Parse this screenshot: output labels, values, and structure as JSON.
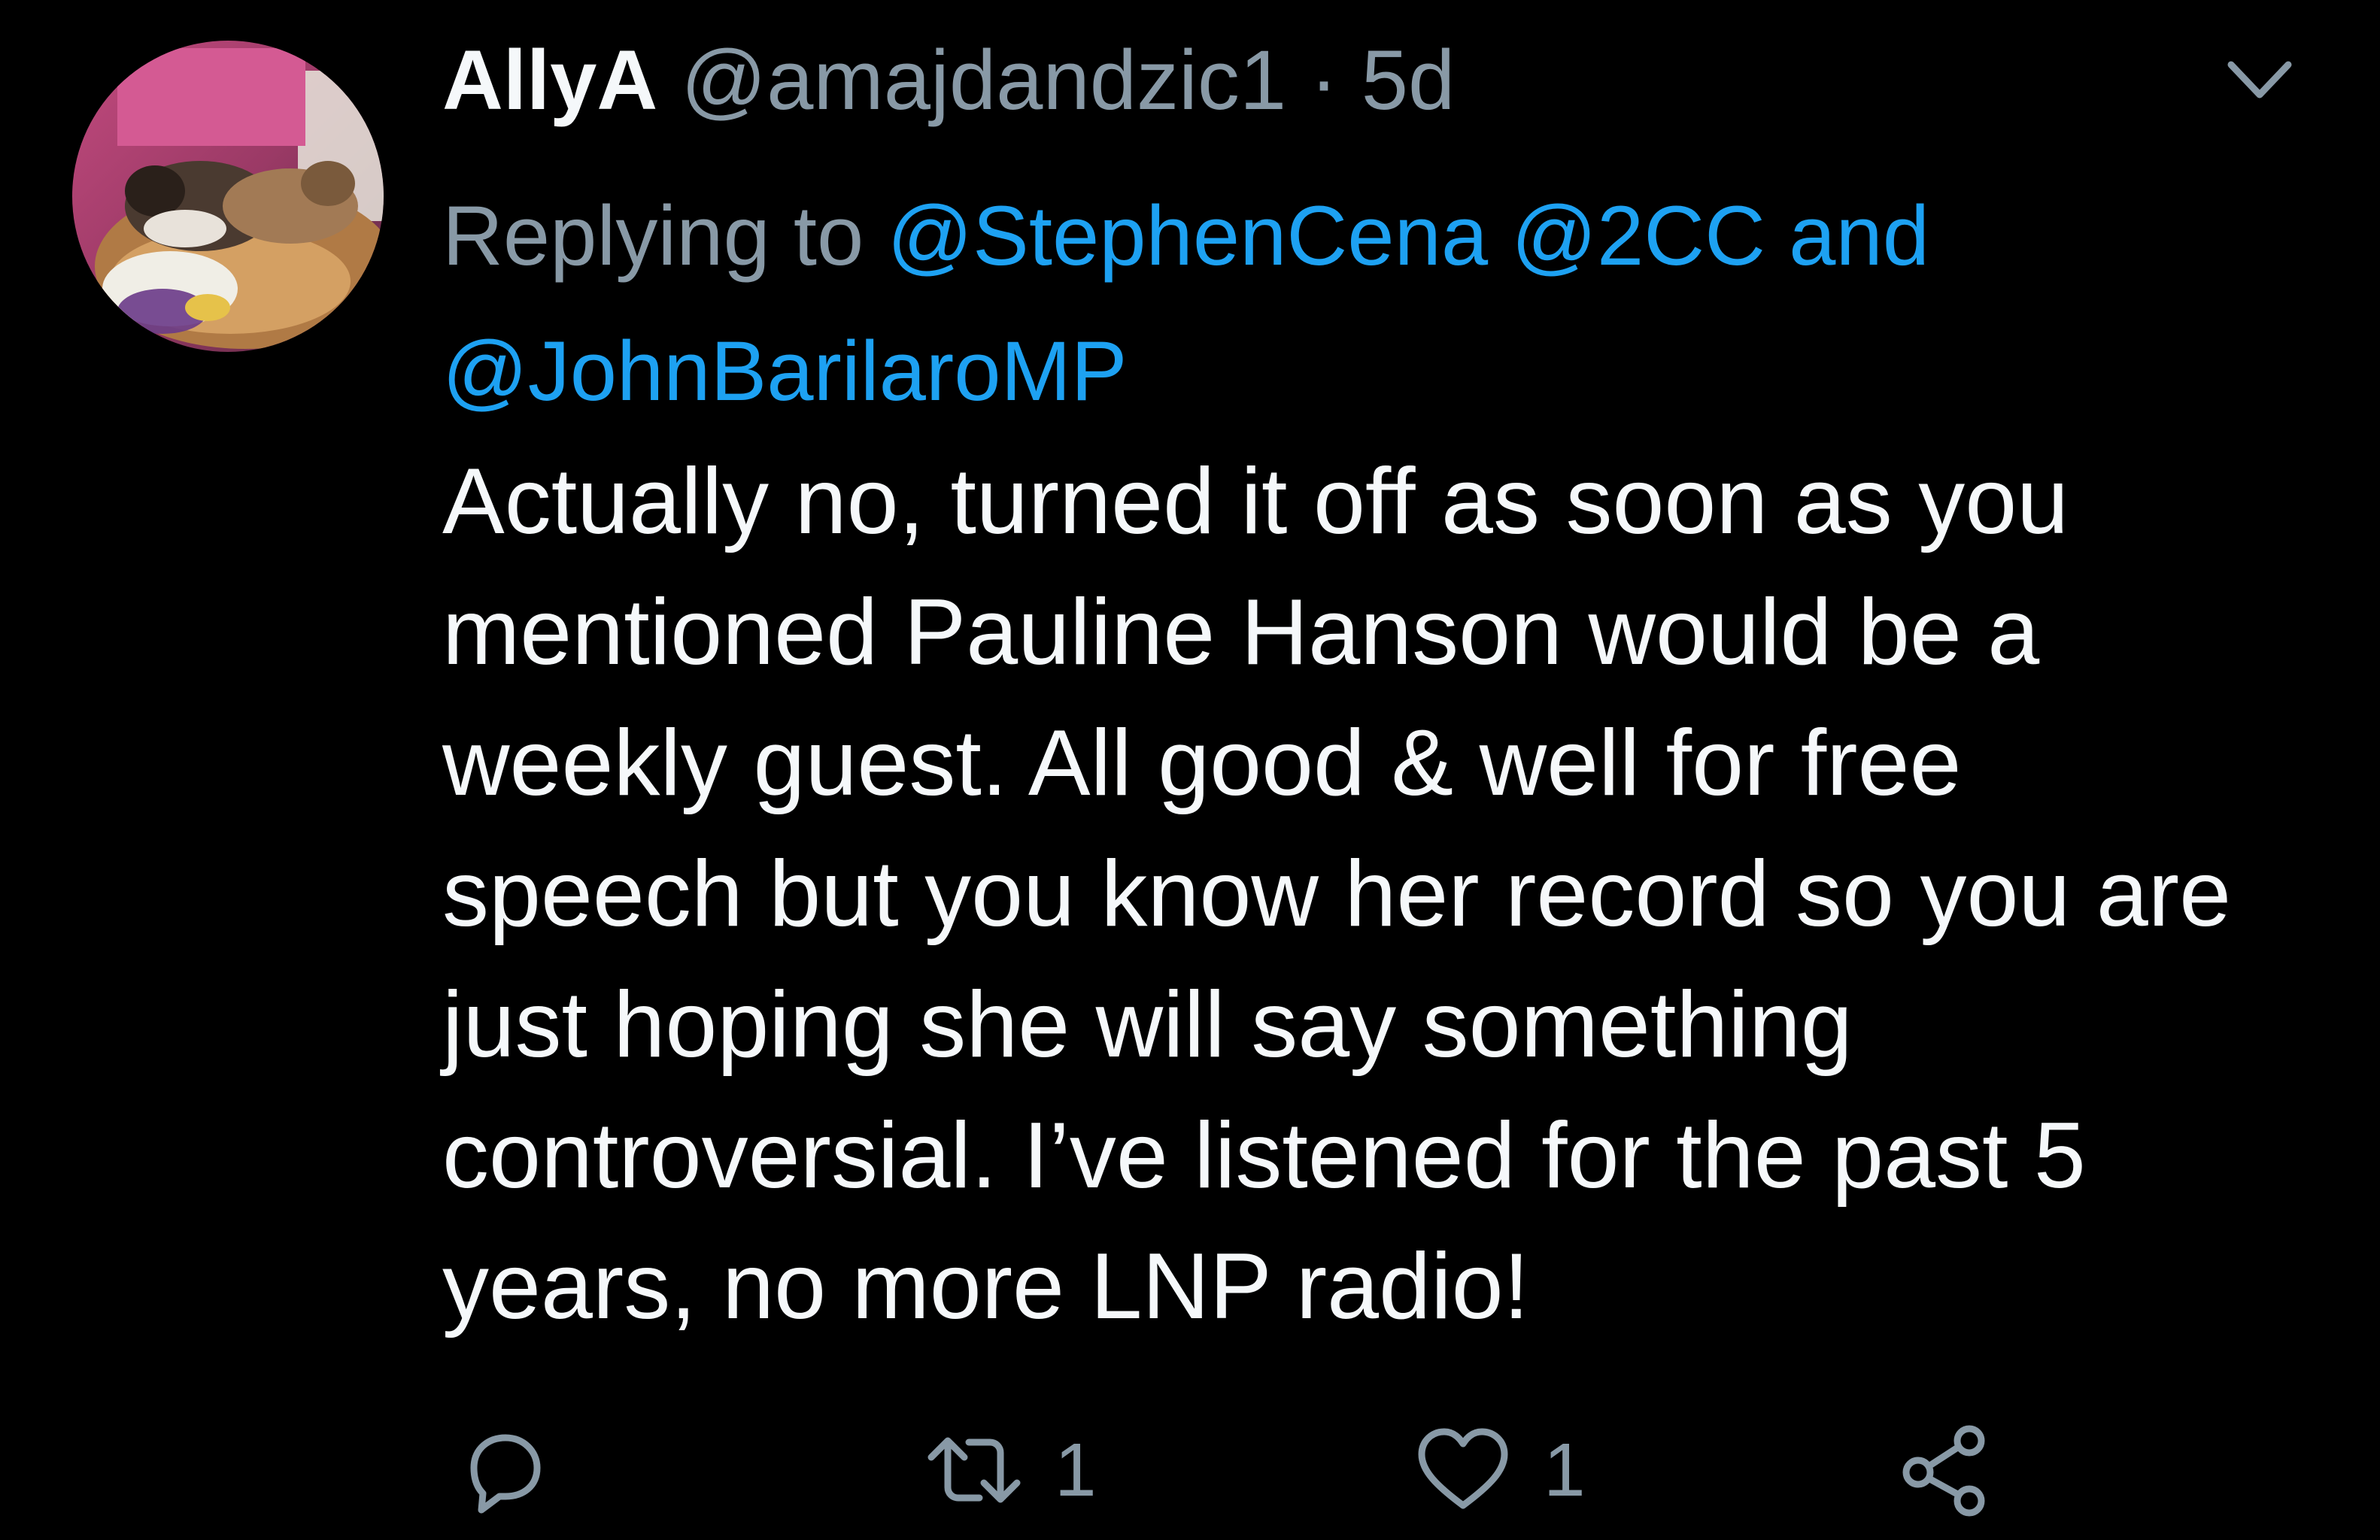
{
  "tweet": {
    "display_name": "AllyA",
    "handle": "@amajdandzic1",
    "separator": "·",
    "time": "5d",
    "replying_to_label": "Replying to",
    "mentions": [
      "@StephenCena",
      "@2CC"
    ],
    "mention_joiner": "and",
    "mention_last": "@JohnBarilaroMP",
    "text": "Actually no, turned it off as soon as you mentioned Pauline Hanson would be a weekly guest. All good & well for free speech but you know her record so you are just hoping she will say something controversial. I’ve listened for the past 5 years, no more LNP radio!",
    "icons": {
      "avatar": "avatar-photo-dogs",
      "menu": "chevron-down-icon",
      "reply": "reply-icon",
      "retweet": "retweet-icon",
      "like": "heart-icon",
      "share": "share-icon"
    },
    "counts": {
      "retweets": "1",
      "likes": "1"
    }
  },
  "colors": {
    "background": "#000000",
    "text": "#f5f8fa",
    "secondary": "#8899a6",
    "link": "#1da1f2"
  }
}
